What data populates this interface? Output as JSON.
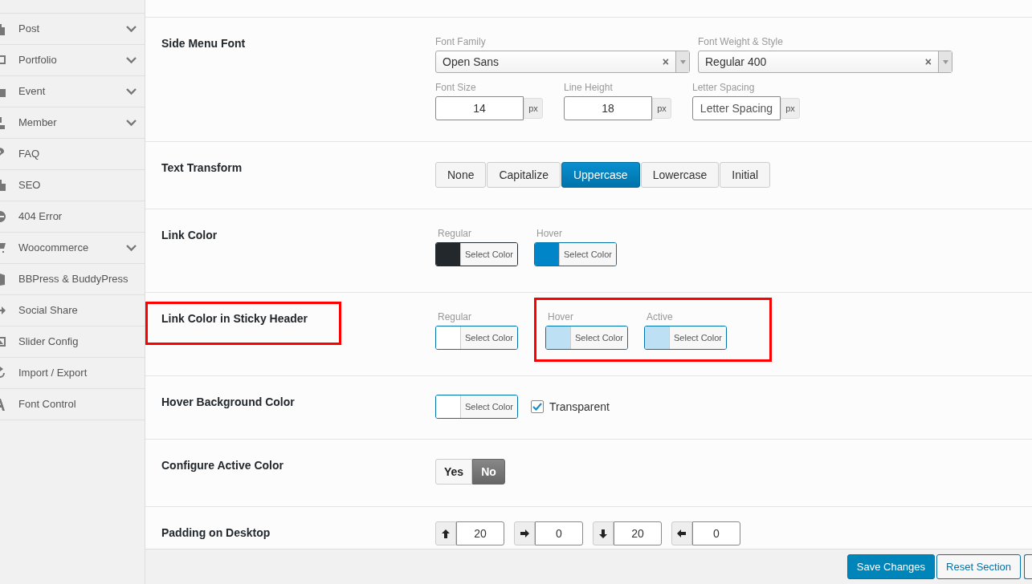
{
  "sidebar": {
    "items": [
      {
        "label": "Post",
        "expandable": true
      },
      {
        "label": "Portfolio",
        "expandable": true
      },
      {
        "label": "Event",
        "expandable": true
      },
      {
        "label": "Member",
        "expandable": true
      },
      {
        "label": "FAQ",
        "expandable": false
      },
      {
        "label": "SEO",
        "expandable": false
      },
      {
        "label": "404 Error",
        "expandable": false
      },
      {
        "label": "Woocommerce",
        "expandable": true
      },
      {
        "label": "BBPress & BuddyPress",
        "expandable": false
      },
      {
        "label": "Social Share",
        "expandable": false
      },
      {
        "label": "Slider Config",
        "expandable": false
      },
      {
        "label": "Import / Export",
        "expandable": false
      },
      {
        "label": "Font Control",
        "expandable": false
      }
    ]
  },
  "sections": [
    {
      "kind": "font",
      "title": "Side Menu Font",
      "highlighted": false,
      "font_family": {
        "label": "Font Family",
        "value": "Open Sans",
        "clear": "×"
      },
      "font_weight": {
        "label": "Font Weight & Style",
        "value": "Regular 400",
        "clear": "×"
      },
      "sizes": [
        {
          "label": "Font Size",
          "value": "14",
          "unit": "px"
        },
        {
          "label": "Line Height",
          "value": "18",
          "unit": "px"
        },
        {
          "label": "Letter Spacing",
          "placeholder": "Letter Spacing",
          "unit": "px"
        }
      ]
    },
    {
      "kind": "buttons",
      "title": "Text Transform",
      "highlighted": false,
      "options": [
        {
          "label": "None",
          "selected": false
        },
        {
          "label": "Capitalize",
          "selected": false
        },
        {
          "label": "Uppercase",
          "selected": true
        },
        {
          "label": "Lowercase",
          "selected": false
        },
        {
          "label": "Initial",
          "selected": false
        }
      ]
    },
    {
      "kind": "colors",
      "title": "Link Color",
      "highlighted": false,
      "groups": [
        {
          "highlighted": false,
          "colors": [
            {
              "label": "Regular",
              "color": "#23282d",
              "button": "Select Color"
            },
            {
              "label": "Hover",
              "color": "#0085c8",
              "button": "Select Color"
            }
          ]
        }
      ]
    },
    {
      "kind": "colors",
      "title": "Link Color in Sticky Header",
      "highlighted": true,
      "groups": [
        {
          "highlighted": false,
          "colors": [
            {
              "label": "Regular",
              "color": "#ffffff",
              "button": "Select Color"
            }
          ]
        },
        {
          "highlighted": true,
          "colors": [
            {
              "label": "Hover",
              "color": "#bde0f4",
              "button": "Select Color"
            },
            {
              "label": "Active",
              "color": "#bde0f4",
              "button": "Select Color"
            }
          ]
        }
      ]
    },
    {
      "kind": "transparent",
      "title": "Hover Background Color",
      "highlighted": false,
      "color": "#ffffff",
      "button": "Select Color",
      "checkbox": {
        "label": "Transparent",
        "checked": true
      }
    },
    {
      "kind": "toggle",
      "title": "Configure Active Color",
      "highlighted": false,
      "options": [
        {
          "label": "Yes",
          "selected": false
        },
        {
          "label": "No",
          "selected": true
        }
      ]
    },
    {
      "kind": "padding",
      "title": "Padding on Desktop",
      "highlighted": false,
      "fields": [
        {
          "value": "20"
        },
        {
          "value": "0"
        },
        {
          "value": "20"
        },
        {
          "value": "0"
        }
      ]
    }
  ],
  "footer": {
    "buttons": [
      {
        "label": "Save Changes",
        "primary": true
      },
      {
        "label": "Reset Section",
        "primary": false
      }
    ]
  }
}
